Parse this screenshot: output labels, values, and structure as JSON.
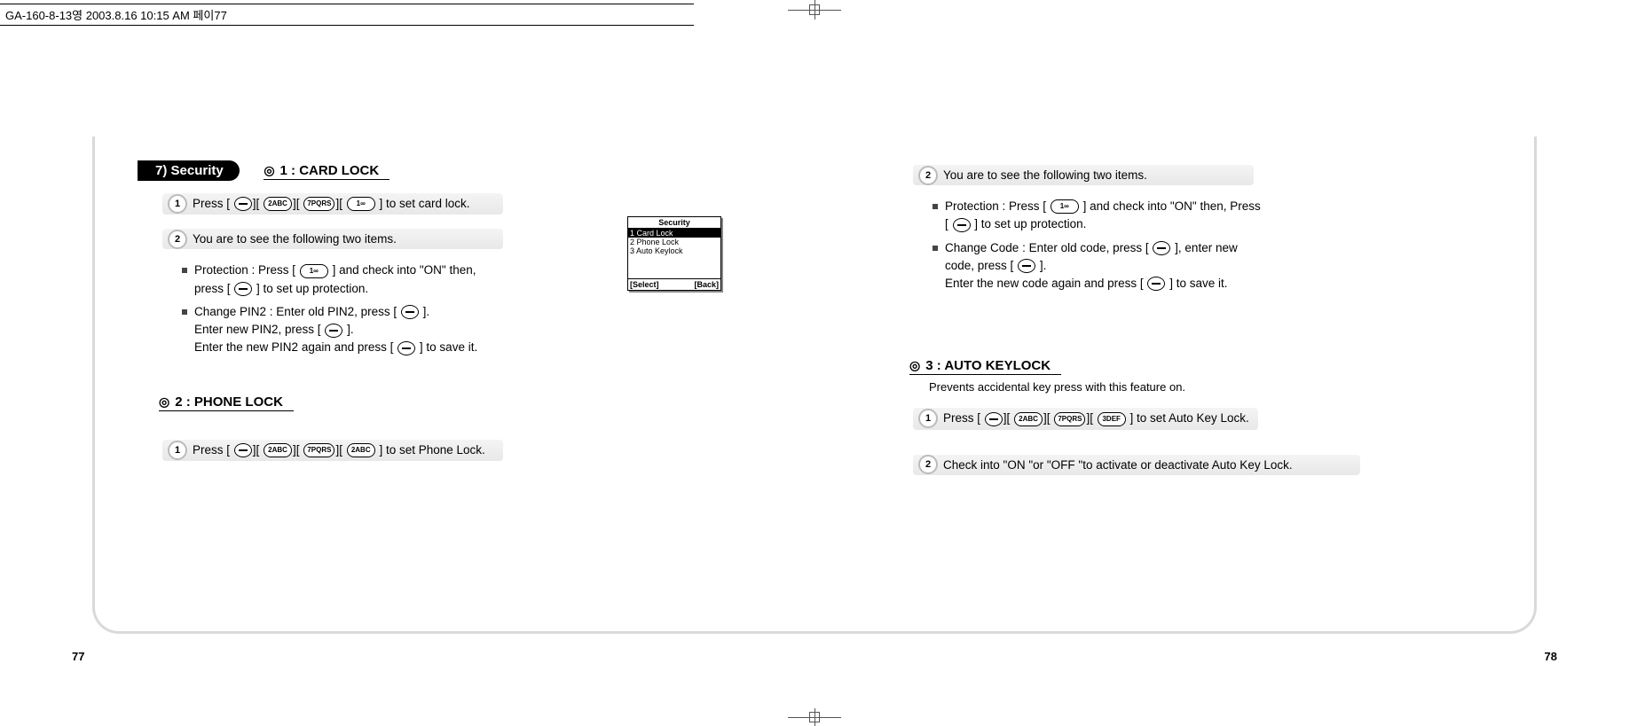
{
  "header": "GA-160-8-13영   2003.8.16 10:15 AM   페이77",
  "section_pill": "7) Security",
  "left": {
    "h1": "1 : CARD LOCK",
    "step1_pre": "Press [",
    "step1_post": "] to set card lock.",
    "step2": "You are to see the following two items.",
    "b1a": "Protection : Press [",
    "b1b": "] and check into \"ON\" then,",
    "b1c": "press [",
    "b1d": "] to set up protection.",
    "b2a": "Change PIN2 : Enter old PIN2, press [",
    "b2b": "].",
    "b2c": "Enter new PIN2, press [",
    "b2d": "].",
    "b2e": "Enter the new PIN2 again and press [",
    "b2f": "] to save it.",
    "h2": "2 : PHONE LOCK",
    "p2_step1_pre": "Press [",
    "p2_step1_post": "] to set Phone Lock."
  },
  "right": {
    "step2": "You are to see the following two items.",
    "b1a": "Protection : Press [",
    "b1b": "] and check into \"ON\" then, Press",
    "b1c": "[",
    "b1d": "] to set up protection.",
    "b2a": "Change Code : Enter old code, press [",
    "b2b": "], enter new",
    "b2c": "code, press [",
    "b2d": "].",
    "b2e": "Enter the new code again and press [",
    "b2f": "] to save it.",
    "h3": "3 : AUTO KEYLOCK",
    "h3desc": "Prevents accidental key press with this feature on.",
    "a_step1_pre": "Press [",
    "a_step1_post": "] to set Auto Key Lock.",
    "a_step2": "Check into \"ON \"or \"OFF \"to activate or deactivate Auto Key Lock."
  },
  "screen": {
    "title": "Security",
    "item1": "1 Card Lock",
    "item2": "2 Phone Lock",
    "item3": "3 Auto Keylock",
    "softL": "[Select]",
    "softR": "[Back]"
  },
  "keys": {
    "menu": "━",
    "k1": "1∞",
    "k2": "2ABC",
    "k3": "3DEF",
    "k7": "7PQRS"
  },
  "pages": {
    "left": "77",
    "right": "78"
  },
  "nums": {
    "n1": "1",
    "n2": "2"
  }
}
